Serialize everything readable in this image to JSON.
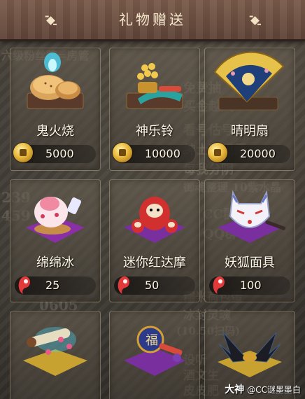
{
  "header": {
    "title": "礼物赠送"
  },
  "gifts": [
    {
      "name": "鬼火烧",
      "price": "5000",
      "currency": "coin-icon"
    },
    {
      "name": "神乐铃",
      "price": "10000",
      "currency": "coin-icon"
    },
    {
      "name": "晴明扇",
      "price": "20000",
      "currency": "coin-icon"
    },
    {
      "name": "绵绵冰",
      "price": "25",
      "currency": "magatama-icon"
    },
    {
      "name": "迷你红达摩",
      "price": "50",
      "currency": "magatama-icon"
    },
    {
      "name": "妖狐面具",
      "price": "100",
      "currency": "magatama-icon"
    },
    {
      "name": "",
      "price": "",
      "currency": ""
    },
    {
      "name": "",
      "price": "",
      "currency": ""
    },
    {
      "name": "",
      "price": "",
      "currency": ""
    }
  ],
  "background_text": {
    "line1": "六级粉丝牌=房管",
    "line2": "免费抽",
    "line3": "买金越尺",
    "line4": "看号估号",
    "line5": "绅士阴阳师",
    "line6": "每我分阴",
    "line7": "御魂整理 10紫水晶",
    "line8": "CC群 24",
    "line9": "QQ群 8",
    "line10": "糯米荷包蛋",
    "line11": "冰封灵魂",
    "line12": "(10.50扫码)",
    "line13": "设听",
    "line14": "酒文生",
    "line15": "皮皮肥",
    "nums1": "239",
    "nums2": "459",
    "nums3": "0605"
  },
  "watermark": {
    "brand": "大神",
    "user": "@CC谜墨墨白"
  },
  "colors": {
    "header": "#6e5040",
    "card_border": "#c8b996",
    "coin": "#e8b93a",
    "magatama": "#d8343a"
  }
}
